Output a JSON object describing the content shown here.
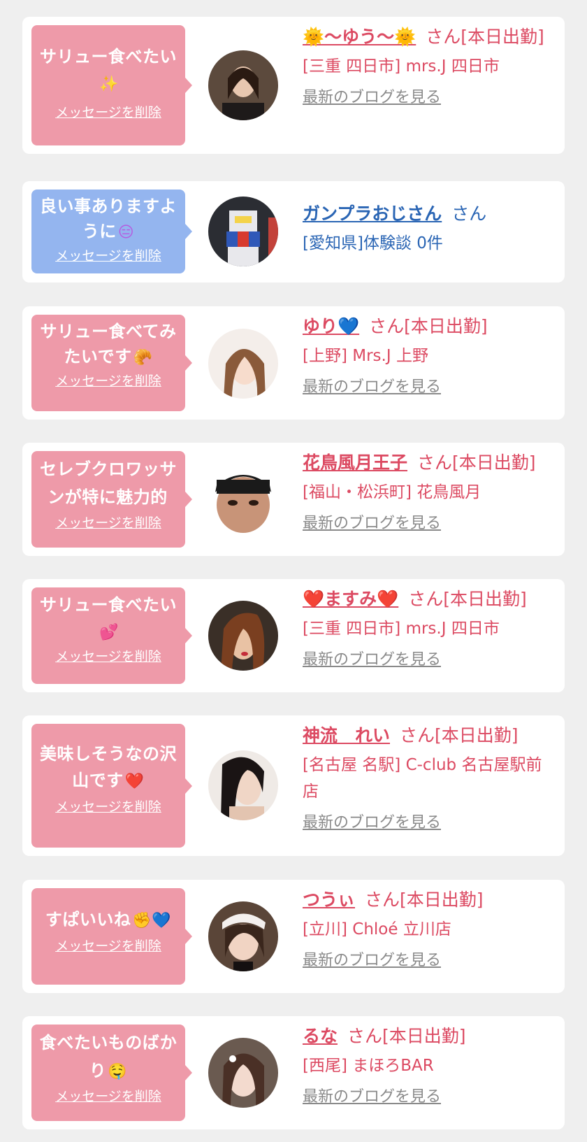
{
  "delete_label": "メッセージを削除",
  "blog_label": "最新のブログを見る",
  "san": "さん",
  "colors": {
    "pink": "#ee9aa9",
    "blue": "#94b5ef",
    "name_pink": "#dc4a62",
    "name_blue": "#2a65b4"
  },
  "cards": [
    {
      "message": "サリュー食べたい",
      "message_emoji": "✨",
      "name": "🌞〜ゆう〜🌞",
      "status": "[本日出勤]",
      "shop": "[三重 四日市] mrs.J 四日市"
    },
    {
      "message": "良い事ありますように",
      "message_emoji": "😑",
      "name": "ガンプラおじさん",
      "status": "",
      "shop": "[愛知県]体験談 0件"
    },
    {
      "message": "サリュー食べてみたいです",
      "message_emoji": "🥐",
      "name": "ゆり💙",
      "status": "[本日出勤]",
      "shop": "[上野] Mrs.J 上野"
    },
    {
      "message": "セレブクロワッサンが特に魅力的",
      "message_emoji": "",
      "name": "花鳥風月王子",
      "status": "[本日出勤]",
      "shop": "[福山・松浜町] 花鳥風月"
    },
    {
      "message": "サリュー食べたい",
      "message_emoji": "💕",
      "name": "❤️ますみ❤️",
      "status": "[本日出勤]",
      "shop": "[三重 四日市] mrs.J 四日市"
    },
    {
      "message": "美味しそうなの沢山です",
      "message_emoji": "❤️",
      "name": "神流　れい",
      "status": "[本日出勤]",
      "shop": "[名古屋 名駅] C-club 名古屋駅前店"
    },
    {
      "message": "すぱいいね",
      "message_emoji": "✊💙",
      "name": "つうぃ",
      "status": "[本日出勤]",
      "shop": "[立川] Chloé 立川店"
    },
    {
      "message": "食べたいものばかり",
      "message_emoji": "🤤",
      "name": "るな",
      "status": "[本日出勤]",
      "shop": "[西尾] まほろBAR"
    }
  ]
}
